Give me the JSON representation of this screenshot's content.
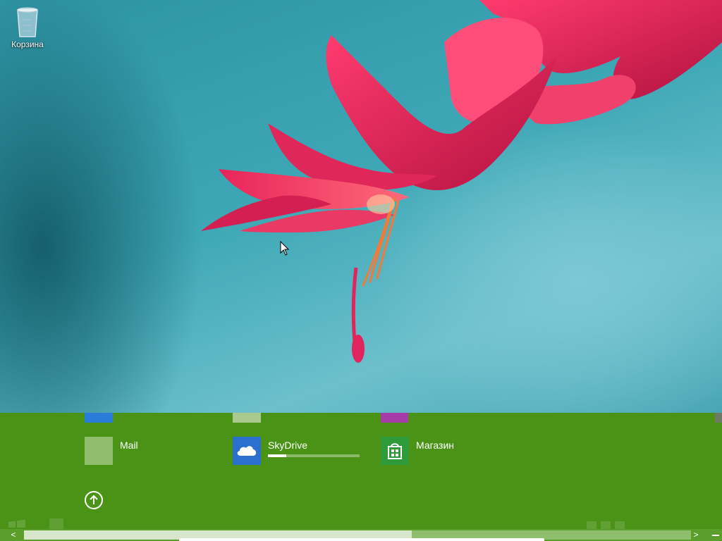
{
  "desktop": {
    "recycle_bin": {
      "label": "Корзина",
      "icon": "recycle-bin-icon"
    }
  },
  "start_screen": {
    "background_color": "#4a9317",
    "apps": [
      {
        "name": "Mail",
        "icon": "mail-icon",
        "color": "#8fbf6c"
      },
      {
        "name": "SkyDrive",
        "icon": "skydrive-cloud-icon",
        "color": "#2b6fcf",
        "download_progress": 0.2
      },
      {
        "name": "Магазин",
        "icon": "store-icon",
        "color": "#2f9a3a"
      }
    ],
    "partial_row_colors": [
      "#2b7bd9",
      "#a9c98e",
      "#a53ca8"
    ]
  },
  "scrollbar": {
    "left_arrow": "<",
    "right_arrow": ">"
  }
}
